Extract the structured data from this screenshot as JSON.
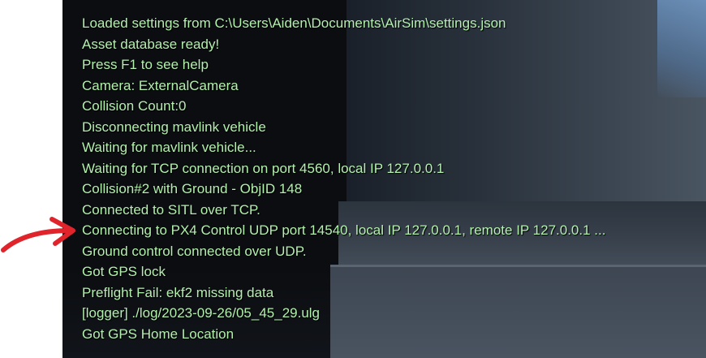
{
  "colors": {
    "log_text": "#b3f0ad",
    "annotation_arrow": "#e0242b"
  },
  "annotation": {
    "icon": "red-arrow-icon",
    "points_to_line": 11
  },
  "log": {
    "lines": [
      "Loaded settings from C:\\Users\\Aiden\\Documents\\AirSim\\settings.json",
      "Asset database ready!",
      "Press F1 to see help",
      "Camera: ExternalCamera",
      "Collision Count:0",
      "Disconnecting mavlink vehicle",
      "Waiting for mavlink vehicle...",
      "Waiting for TCP connection on port 4560, local IP 127.0.0.1",
      "Collision#2 with Ground - ObjID 148",
      "Connected to SITL over TCP.",
      "Connecting to PX4 Control UDP port 14540, local IP 127.0.0.1, remote IP 127.0.0.1 ...",
      "Ground control connected over UDP.",
      "Got GPS lock",
      "Preflight Fail: ekf2 missing data",
      "[logger] ./log/2023-09-26/05_45_29.ulg",
      "Got GPS Home Location"
    ]
  }
}
